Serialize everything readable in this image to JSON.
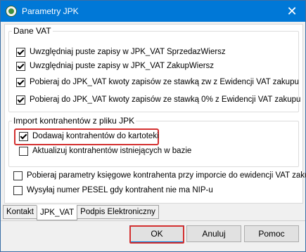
{
  "window": {
    "title": "Parametry JPK"
  },
  "groups": {
    "dane_vat": {
      "legend": "Dane VAT",
      "options": [
        {
          "label": "Uwzględniaj puste zapisy w JPK_VAT SprzedazWiersz",
          "checked": true
        },
        {
          "label": "Uwzględniaj puste zapisy w JPK_VAT ZakupWiersz",
          "checked": true
        },
        {
          "label": "Pobieraj do JPK_VAT kwoty zapisów ze stawką zw z Ewidencji VAT zakupu",
          "checked": true
        },
        {
          "label": "Pobieraj do JPK_VAT kwoty zapisów ze stawką 0% z Ewidencji VAT zakupu",
          "checked": true
        }
      ]
    },
    "import": {
      "legend": "Import kontrahentów z pliku JPK",
      "options": [
        {
          "label": "Dodawaj kontrahentów do kartoteki",
          "checked": true
        },
        {
          "label": "Aktualizuj kontrahentów istniejących w bazie",
          "checked": false
        }
      ]
    }
  },
  "other_options": [
    {
      "label": "Pobieraj parametry księgowe kontrahenta przy imporcie do ewidencji VAT zakupu",
      "checked": false
    },
    {
      "label": "Wysyłaj numer PESEL gdy kontrahent nie ma NIP-u",
      "checked": false
    }
  ],
  "tabs": [
    {
      "label": "Kontakt",
      "active": false
    },
    {
      "label": "JPK_VAT",
      "active": true
    },
    {
      "label": "Podpis Elektroniczny",
      "active": false
    }
  ],
  "buttons": {
    "ok": "OK",
    "cancel": "Anuluj",
    "help": "Pomoc"
  },
  "colors": {
    "titlebar": "#0078d7",
    "highlight": "#d32f2f"
  }
}
